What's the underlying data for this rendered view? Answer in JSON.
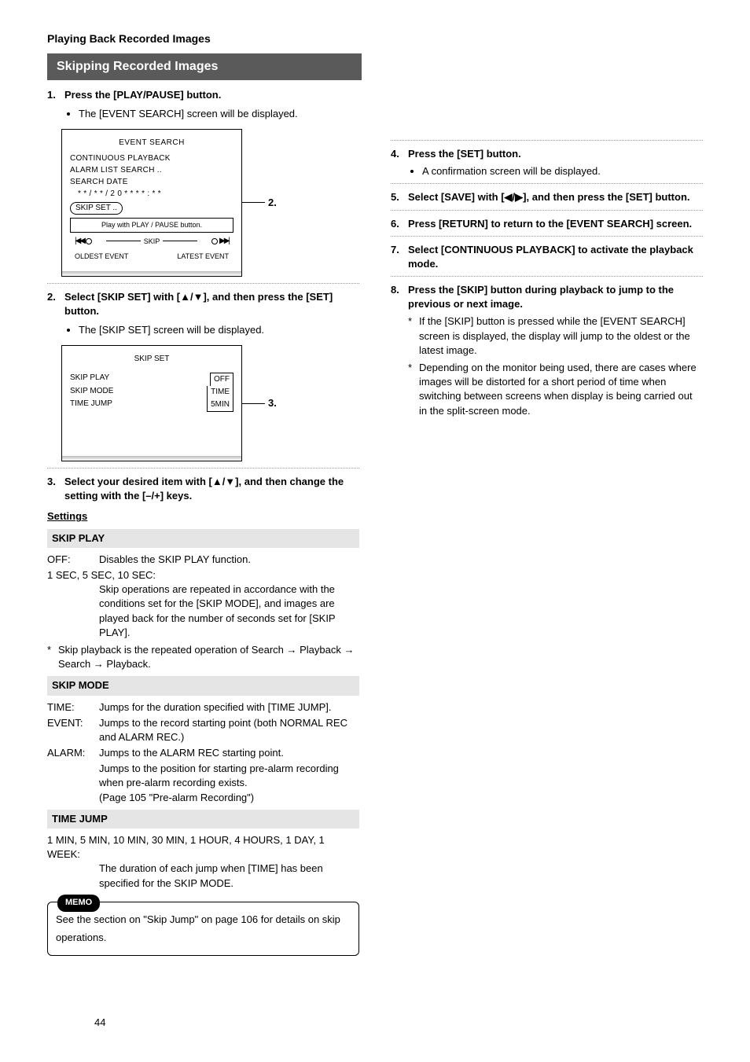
{
  "page": {
    "section": "Playing Back Recorded Images",
    "title": "Skipping Recorded Images",
    "number": "44"
  },
  "left": {
    "step1": {
      "num": "1.",
      "text": "Press the [PLAY/PAUSE] button.",
      "bullet": "The [EVENT SEARCH] screen will be displayed."
    },
    "screen1": {
      "title": "EVENT SEARCH",
      "l1": "CONTINUOUS PLAYBACK",
      "l2": "ALARM LIST SEARCH ..",
      "l3": "SEARCH DATE",
      "l4": "* * / * * / 2 0 * *   * * : * *",
      "skip": "SKIP SET ..",
      "play": "Play with PLAY / PAUSE button.",
      "skip_label": "SKIP",
      "oldest": "OLDEST EVENT",
      "latest": "LATEST EVENT",
      "callout": "2."
    },
    "step2": {
      "num": "2.",
      "text": "Select [SKIP SET] with [▲/▼], and then press the [SET] button.",
      "bullet": "The [SKIP SET] screen will be displayed."
    },
    "screen2": {
      "title": "SKIP SET",
      "r1k": "SKIP PLAY",
      "r1v": "OFF",
      "r2k": "SKIP MODE",
      "r2v": "TIME",
      "r3k": "TIME JUMP",
      "r3v": "5MIN",
      "callout": "3."
    },
    "step3": {
      "num": "3.",
      "text": "Select your desired item with [▲/▼], and then change the setting with the [–/+] keys."
    },
    "settings_label": "Settings",
    "skip_play": {
      "title": "SKIP PLAY",
      "off_k": "OFF:",
      "off_v": "Disables the SKIP PLAY function.",
      "sec": "1 SEC, 5 SEC, 10 SEC:",
      "sec_v": "Skip operations are repeated in accordance with the conditions set for the [SKIP MODE], and images are played back for the number of seconds set for [SKIP PLAY].",
      "note": "Skip playback is the repeated operation of Search → Playback → Search → Playback."
    },
    "skip_mode": {
      "title": "SKIP MODE",
      "time_k": "TIME:",
      "time_v": "Jumps for the duration specified with [TIME JUMP].",
      "event_k": "EVENT:",
      "event_v": "Jumps to the record starting point (both NORMAL REC and ALARM REC.)",
      "alarm_k": "ALARM:",
      "alarm_v": "Jumps to the ALARM REC starting point.",
      "alarm_v2": "Jumps to the position for starting pre-alarm recording when pre-alarm recording exists.",
      "alarm_v3": "(Page 105 \"Pre-alarm Recording\")"
    },
    "time_jump": {
      "title": "TIME JUMP",
      "opts": "1 MIN, 5 MIN, 10 MIN, 30 MIN, 1 HOUR, 4 HOURS, 1 DAY, 1 WEEK:",
      "desc": "The duration of each jump when [TIME] has been specified for the SKIP MODE."
    },
    "memo": {
      "tag": "MEMO",
      "text": "See the section on \"Skip Jump\" on page 106 for details on skip operations."
    }
  },
  "right": {
    "s4": {
      "n": "4.",
      "t": "Press the [SET] button.",
      "b": "A confirmation screen will be displayed."
    },
    "s5": {
      "n": "5.",
      "t": "Select [SAVE] with [◀/▶], and then press the [SET] button."
    },
    "s6": {
      "n": "6.",
      "t": "Press [RETURN] to return to the [EVENT SEARCH] screen."
    },
    "s7": {
      "n": "7.",
      "t": "Select [CONTINUOUS PLAYBACK] to activate the playback mode."
    },
    "s8": {
      "n": "8.",
      "t": "Press the [SKIP] button during playback to jump to the previous or next image.",
      "n1": "If the [SKIP] button is pressed while the [EVENT SEARCH] screen is displayed, the display will jump to the oldest or the latest image.",
      "n2": "Depending on the monitor being used, there are cases where images will be distorted for a short period of time when switching between screens when display is being carried out in the split-screen mode."
    }
  }
}
